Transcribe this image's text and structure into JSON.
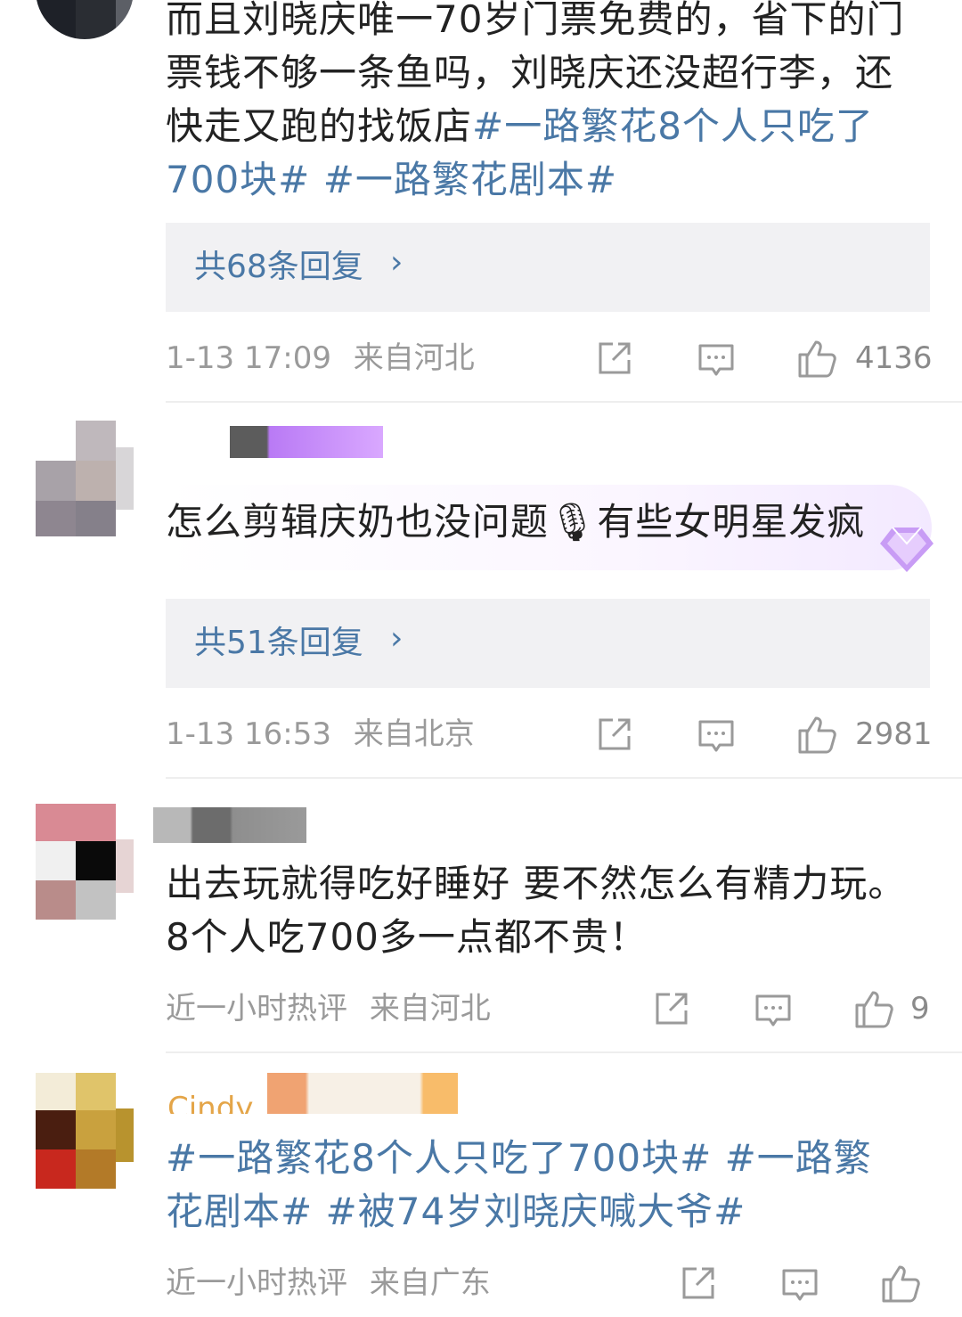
{
  "comments": [
    {
      "text_parts": [
        {
          "t": "而且刘晓庆唯一70岁门票免费的，省下的门票钱不够一条鱼吗，刘晓庆还没超行李，还快走又跑的找饭店",
          "tag": false
        },
        {
          "t": "#一路繁花8个人只吃了700块# #一路繁花剧本#",
          "tag": true
        }
      ],
      "replies_label": "共68条回复",
      "time": "1-13 17:09",
      "location": "来自河北",
      "likes": "4136"
    },
    {
      "text_parts": [
        {
          "t": "怎么剪辑庆奶也没问题🎙有些女明星发疯",
          "tag": false
        }
      ],
      "replies_label": "共51条回复",
      "time": "1-13 16:53",
      "location": "来自北京",
      "likes": "2981"
    },
    {
      "text_parts": [
        {
          "t": "出去玩就得吃好睡好 要不然怎么有精力玩。8个人吃700多一点都不贵！",
          "tag": false
        }
      ],
      "time": "近一小时热评",
      "location": "来自河北",
      "likes": "9"
    },
    {
      "username_partial": "Cindy",
      "text_parts": [
        {
          "t": "#一路繁花8个人只吃了700块# #一路繁花剧本# #被74岁刘晓庆喊大爷#",
          "tag": true
        }
      ],
      "time": "近一小时热评",
      "location": "来自广东",
      "likes": ""
    }
  ],
  "icons": {
    "share": "share-icon",
    "comment": "comment-icon",
    "like": "thumbs-up-icon",
    "chevron": "chevron-right-icon"
  },
  "colors": {
    "link": "#4a78a6",
    "meta": "#9a9a9a",
    "reply_bg": "#f1f1f3"
  }
}
